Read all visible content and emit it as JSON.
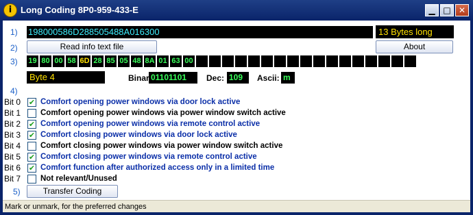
{
  "window": {
    "title": "Long Coding 8P0-959-433-E",
    "app_icon": "info-icon",
    "controls": [
      "minimize",
      "maximize",
      "close"
    ]
  },
  "steps": {
    "s1": "1)",
    "s2": "2)",
    "s3": "3)",
    "s4": "4)",
    "s5": "5)"
  },
  "coding": {
    "value": "198000586D288505488A016300",
    "length_label": "13 Bytes long"
  },
  "buttons": {
    "read_info": "Read info text file",
    "about": "About",
    "transfer": "Transfer Coding"
  },
  "bytes": [
    "19",
    "80",
    "00",
    "58",
    "6D",
    "28",
    "85",
    "05",
    "48",
    "8A",
    "01",
    "63",
    "00",
    "",
    "",
    "",
    "",
    "",
    "",
    "",
    "",
    "",
    "",
    "",
    "",
    "",
    "",
    "",
    "",
    ""
  ],
  "selected_byte_index": 4,
  "byte_info": {
    "byte_label": "Byte 4",
    "binary_label": "Binary:",
    "binary_value": "01101101",
    "dec_label": "Dec:",
    "dec_value": "109",
    "ascii_label": "Ascii:",
    "ascii_value": "m"
  },
  "bits": [
    {
      "label": "Bit 0",
      "checked": true,
      "text": "Comfort opening power windows via door lock active",
      "color": "#0b2fa8"
    },
    {
      "label": "Bit 1",
      "checked": false,
      "text": "Comfort opening power windows via power window switch active",
      "color": "#000000"
    },
    {
      "label": "Bit 2",
      "checked": true,
      "text": "Comfort opening power windows via remote control active",
      "color": "#0b2fa8"
    },
    {
      "label": "Bit 3",
      "checked": true,
      "text": "Comfort closing power windows via door lock active",
      "color": "#0b2fa8"
    },
    {
      "label": "Bit 4",
      "checked": false,
      "text": "Comfort closing power windows via power window switch active",
      "color": "#000000"
    },
    {
      "label": "Bit 5",
      "checked": true,
      "text": "Comfort closing power windows via remote control active",
      "color": "#0b2fa8"
    },
    {
      "label": "Bit 6",
      "checked": true,
      "text": "Comfort function after authorized access only in a limited time",
      "color": "#0b2fa8"
    },
    {
      "label": "Bit 7",
      "checked": false,
      "text": "Not relevant/Unused",
      "color": "#000000"
    }
  ],
  "status_text": "Mark or unmark, for the preferred changes"
}
